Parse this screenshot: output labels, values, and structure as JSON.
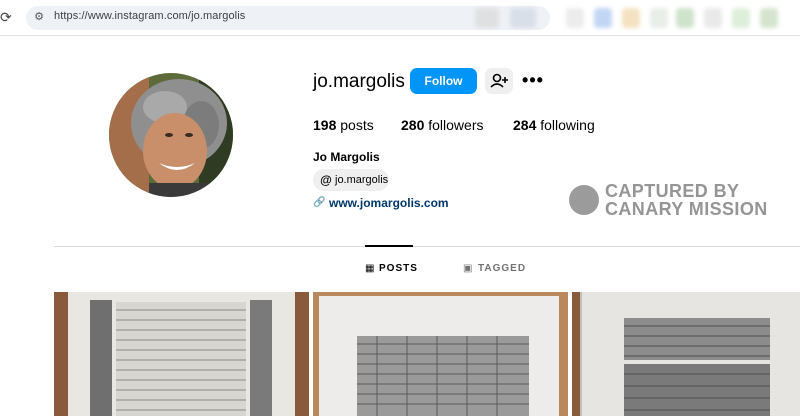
{
  "browser": {
    "url": "https://www.instagram.com/jo.margolis",
    "reload_icon": "reload-icon",
    "site_settings_icon": "tune-icon"
  },
  "profile": {
    "username": "jo.margolis",
    "follow_label": "Follow",
    "add_user_icon": "add-user-icon",
    "more_icon": "more-options-icon",
    "posts_count": "198",
    "posts_label": "posts",
    "followers_count": "280",
    "followers_label": "followers",
    "following_count": "284",
    "following_label": "following",
    "full_name": "Jo Margolis",
    "threads_handle": "jo.margolis",
    "website": "www.jomargolis.com"
  },
  "watermark": {
    "line1": "CAPTURED BY",
    "line2": "CANARY MISSION"
  },
  "tabs": [
    {
      "label": "POSTS",
      "icon": "grid-icon",
      "active": true
    },
    {
      "label": "TAGGED",
      "icon": "tag-icon",
      "active": false
    }
  ],
  "colors": {
    "accent": "#0095f6",
    "link": "#00376b"
  }
}
